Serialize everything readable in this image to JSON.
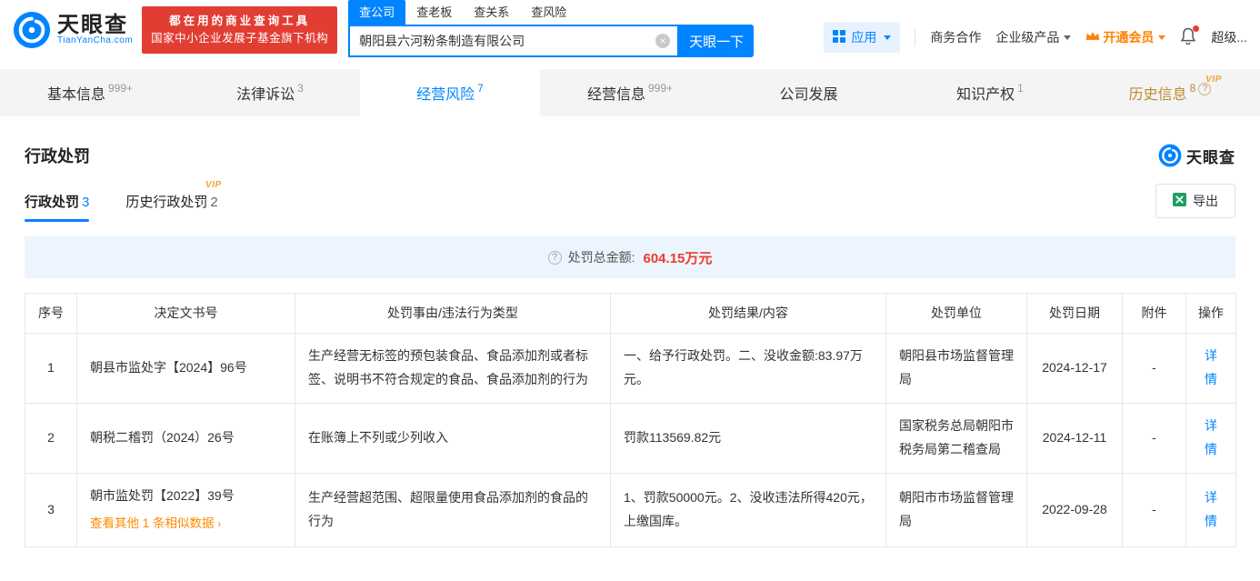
{
  "header": {
    "logo": {
      "title": "天眼查",
      "subtitle": "TianYanCha.com"
    },
    "banner": {
      "line1": "都在用的商业查询工具",
      "line2": "国家中小企业发展子基金旗下机构"
    },
    "search": {
      "tabs": [
        {
          "label": "查公司"
        },
        {
          "label": "查老板"
        },
        {
          "label": "查关系"
        },
        {
          "label": "查风险"
        }
      ],
      "value": "朝阳县六河粉条制造有限公司",
      "button": "天眼一下"
    },
    "actions": {
      "apps": "应用",
      "cooperation": "商务合作",
      "enterprise": "企业级产品",
      "vip": "开通会员",
      "user": "超级..."
    }
  },
  "nav_tabs": [
    {
      "label": "基本信息",
      "count": "999+"
    },
    {
      "label": "法律诉讼",
      "count": "3"
    },
    {
      "label": "经营风险",
      "count": "7"
    },
    {
      "label": "经营信息",
      "count": "999+"
    },
    {
      "label": "公司发展",
      "count": ""
    },
    {
      "label": "知识产权",
      "count": "1"
    },
    {
      "label": "历史信息",
      "count": "8"
    }
  ],
  "badges": {
    "vip": "VIP"
  },
  "section": {
    "title": "行政处罚",
    "brand": "天眼查",
    "subtabs": [
      {
        "label": "行政处罚",
        "count": "3"
      },
      {
        "label": "历史行政处罚",
        "count": "2"
      }
    ],
    "export": "导出",
    "summary": {
      "label": "处罚总金额:",
      "value": "604.15万元"
    }
  },
  "table": {
    "headers": [
      "序号",
      "决定文书号",
      "处罚事由/违法行为类型",
      "处罚结果/内容",
      "处罚单位",
      "处罚日期",
      "附件",
      "操作"
    ],
    "rows": [
      {
        "no": "1",
        "doc_no": "朝县市监处字【2024】96号",
        "reason": "生产经营无标签的预包装食品、食品添加剂或者标签、说明书不符合规定的食品、食品添加剂的行为",
        "result": "一、给予行政处罚。二、没收金额:83.97万元。",
        "unit": "朝阳县市场监督管理局",
        "date": "2024-12-17",
        "attachment": "-",
        "action": "详情"
      },
      {
        "no": "2",
        "doc_no": "朝税二稽罚（2024）26号",
        "reason": "在账簿上不列或少列收入",
        "result": "罚款113569.82元",
        "unit": "国家税务总局朝阳市税务局第二稽查局",
        "date": "2024-12-11",
        "attachment": "-",
        "action": "详情"
      },
      {
        "no": "3",
        "doc_no": "朝市监处罚【2022】39号",
        "similar_link": "查看其他 1 条相似数据",
        "reason": "生产经营超范围、超限量使用食品添加剂的食品的行为",
        "result": "1、罚款50000元。2、没收违法所得420元，上缴国库。",
        "unit": "朝阳市市场监督管理局",
        "date": "2022-09-28",
        "attachment": "-",
        "action": "详情"
      }
    ]
  }
}
